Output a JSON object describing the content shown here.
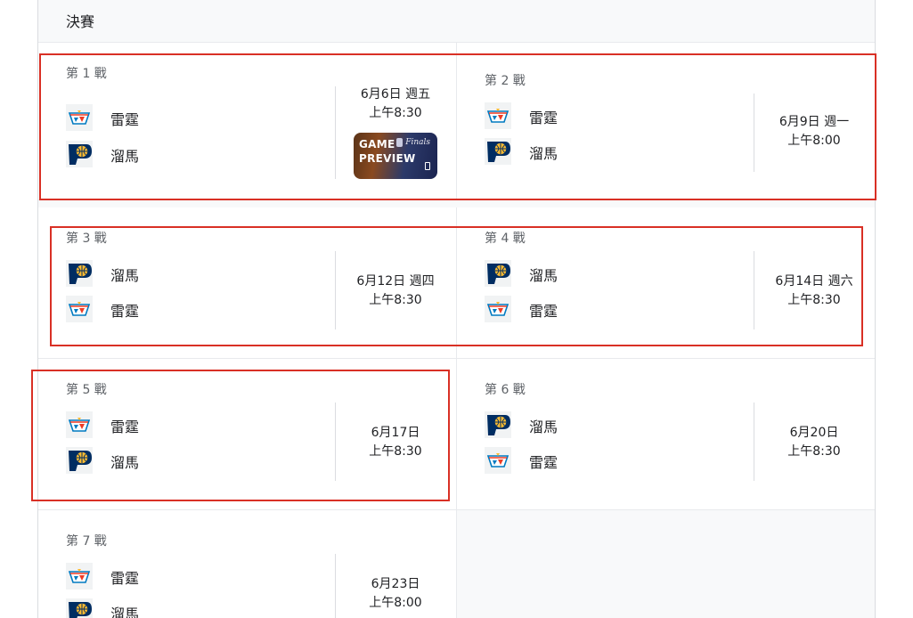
{
  "section_title": "決賽",
  "colors": {
    "highlight": "#d93025",
    "thunder_blue": "#007ac1",
    "thunder_orange": "#ef3b24",
    "pacers_navy": "#002d62",
    "pacers_gold": "#fdbb30"
  },
  "teams": {
    "thunder": {
      "name": "雷霆",
      "icon": "thunder-logo-icon"
    },
    "pacers": {
      "name": "溜馬",
      "icon": "pacers-logo-icon"
    }
  },
  "games": [
    {
      "label": "第 1 戰",
      "team1": "雷霆",
      "team2": "溜馬",
      "date": "6月6日 週五",
      "time": "上午8:30",
      "preview": {
        "line1": "GAME",
        "line2": "PREVIEW",
        "badge": "Finals"
      }
    },
    {
      "label": "第 2 戰",
      "team1": "雷霆",
      "team2": "溜馬",
      "date": "6月9日 週一",
      "time": "上午8:00"
    },
    {
      "label": "第 3 戰",
      "team1": "溜馬",
      "team2": "雷霆",
      "date": "6月12日 週四",
      "time": "上午8:30"
    },
    {
      "label": "第 4 戰",
      "team1": "溜馬",
      "team2": "雷霆",
      "date": "6月14日 週六",
      "time": "上午8:30"
    },
    {
      "label": "第 5 戰",
      "team1": "雷霆",
      "team2": "溜馬",
      "date": "6月17日",
      "time": "上午8:30"
    },
    {
      "label": "第 6 戰",
      "team1": "溜馬",
      "team2": "雷霆",
      "date": "6月20日",
      "time": "上午8:30"
    },
    {
      "label": "第 7 戰",
      "team1": "雷霆",
      "team2": "溜馬",
      "date": "6月23日",
      "time": "上午8:00"
    }
  ]
}
